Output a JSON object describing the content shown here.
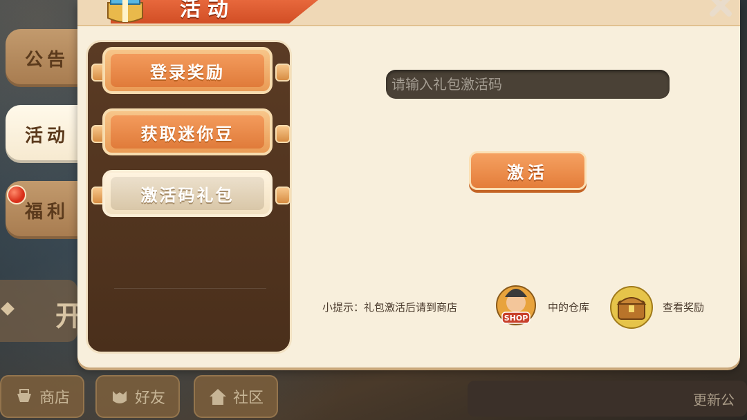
{
  "side_tabs": [
    {
      "label": "公告",
      "active": false
    },
    {
      "label": "活动",
      "active": true
    },
    {
      "label": "福利",
      "active": false
    }
  ],
  "faded_left_text": "开",
  "header": {
    "title": "活动"
  },
  "menu": [
    {
      "label": "登录奖励",
      "active": false
    },
    {
      "label": "获取迷你豆",
      "active": false
    },
    {
      "label": "激活码礼包",
      "active": true
    }
  ],
  "code": {
    "placeholder": "请输入礼包激活码",
    "value": ""
  },
  "activate_label": "激活",
  "tip": {
    "part1": "小提示：礼包激活后请到商店",
    "shop_badge": "SHOP",
    "part2": "中的仓库",
    "part3": "查看奖励"
  },
  "bottom_nav": [
    {
      "label": "商店",
      "icon": "shop-icon"
    },
    {
      "label": "好友",
      "icon": "friends-icon"
    },
    {
      "label": "社区",
      "icon": "home-icon"
    }
  ],
  "news": "更新公",
  "colors": {
    "accent": "#e47d3a",
    "panel": "#f8efdc",
    "list_bg": "#4a2f1b"
  }
}
